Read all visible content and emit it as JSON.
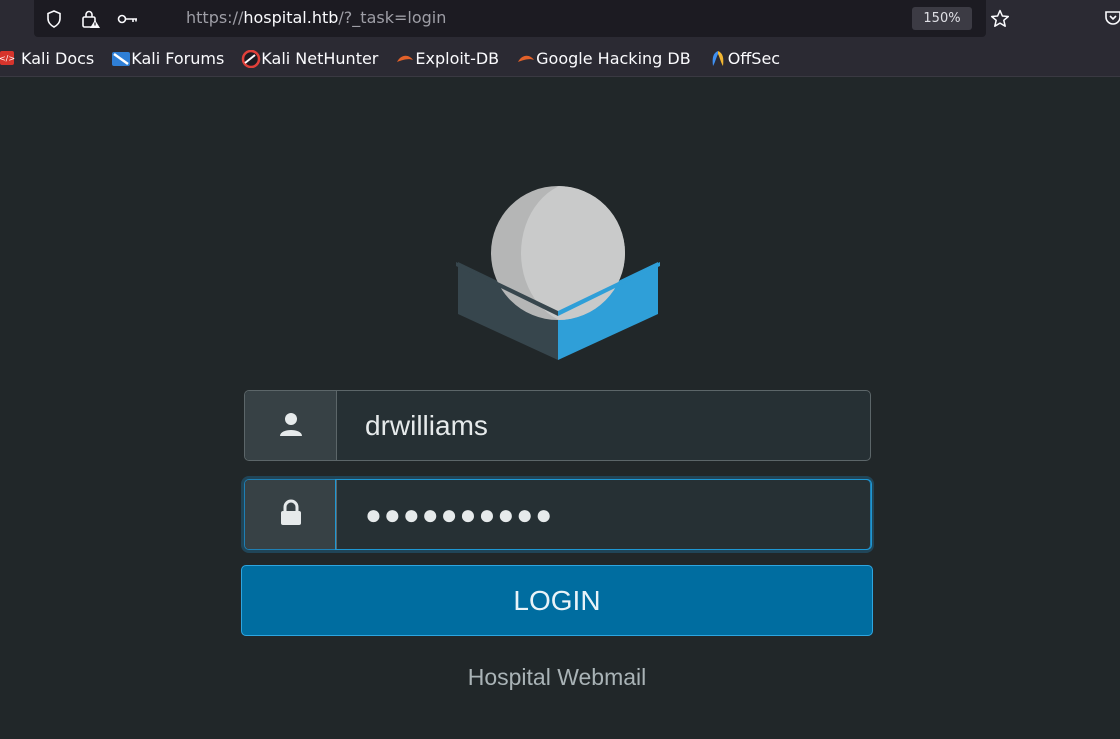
{
  "browser": {
    "url_scheme": "https://",
    "url_host": "hospital.htb",
    "url_path": "/?_task=login",
    "zoom": "150%",
    "bookmarks": [
      {
        "label": "Kali Docs",
        "icon": "kali-docs-icon"
      },
      {
        "label": "Kali Forums",
        "icon": "kali-forums-icon"
      },
      {
        "label": "Kali NetHunter",
        "icon": "kali-nethunter-icon"
      },
      {
        "label": "Exploit-DB",
        "icon": "exploit-db-icon"
      },
      {
        "label": "Google Hacking DB",
        "icon": "ghdb-icon"
      },
      {
        "label": "OffSec",
        "icon": "offsec-icon"
      }
    ]
  },
  "login": {
    "username_value": "drwilliams",
    "password_mask": "●●●●●●●●●●",
    "submit_label": "LOGIN",
    "footer_text": "Hospital Webmail"
  },
  "colors": {
    "page_bg": "#212729",
    "accent": "#006da0",
    "logo_blue": "#2f9fd8"
  }
}
